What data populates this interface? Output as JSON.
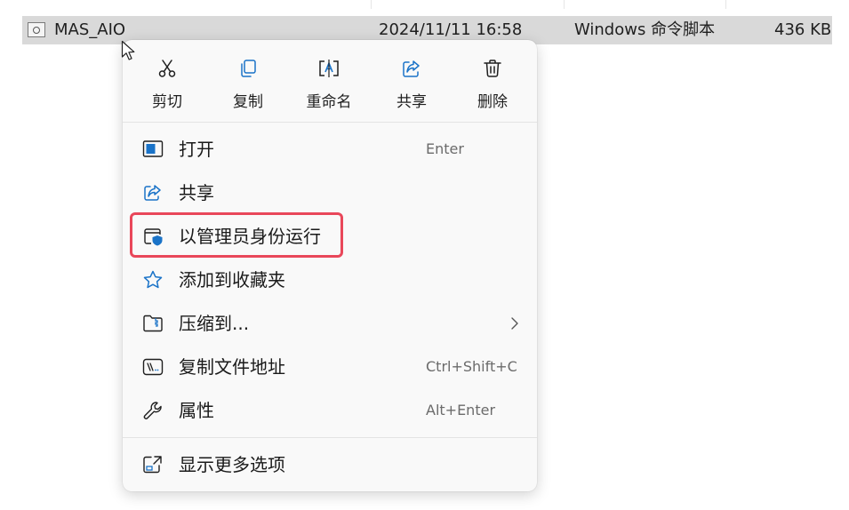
{
  "file": {
    "name": "MAS_AIO",
    "modified": "2024/11/11 16:58",
    "type": "Windows 命令脚本",
    "size": "436 KB",
    "icon": "batch-file-icon"
  },
  "quick_actions": [
    {
      "label": "剪切",
      "icon": "scissors-icon"
    },
    {
      "label": "复制",
      "icon": "copy-icon"
    },
    {
      "label": "重命名",
      "icon": "rename-icon"
    },
    {
      "label": "共享",
      "icon": "share-icon"
    },
    {
      "label": "删除",
      "icon": "trash-icon"
    }
  ],
  "menu_items": [
    {
      "label": "打开",
      "shortcut": "Enter",
      "icon": "open-window-icon"
    },
    {
      "label": "共享",
      "shortcut": "",
      "icon": "share-icon"
    },
    {
      "label": "以管理员身份运行",
      "shortcut": "",
      "icon": "shield-admin-icon"
    },
    {
      "label": "添加到收藏夹",
      "shortcut": "",
      "icon": "star-icon"
    },
    {
      "label": "压缩到...",
      "shortcut": "",
      "icon": "zip-folder-icon",
      "submenu_icon": "chevron-right-icon"
    },
    {
      "label": "复制文件地址",
      "shortcut": "Ctrl+Shift+C",
      "icon": "copy-path-icon"
    },
    {
      "label": "属性",
      "shortcut": "Alt+Enter",
      "icon": "wrench-icon"
    }
  ],
  "more_options": {
    "label": "显示更多选项",
    "icon": "expand-icon"
  },
  "colors": {
    "accent_blue": "#1a73c8",
    "highlight_border": "#e9475a",
    "menu_bg": "#f9f9f9",
    "row_selected": "#d9d9d9"
  }
}
